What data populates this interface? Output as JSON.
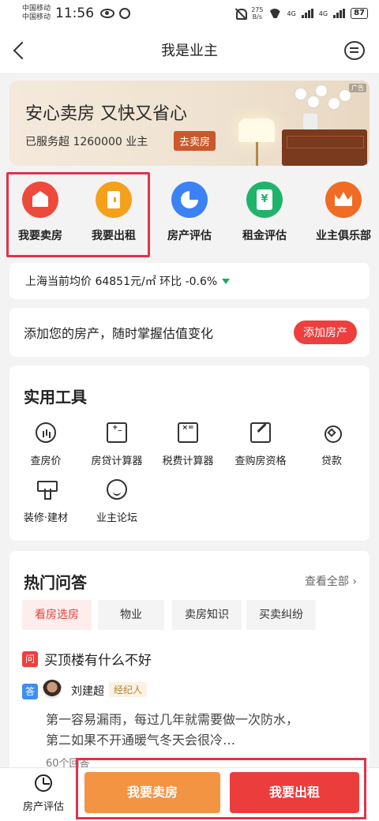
{
  "status_bar": {
    "carrier1": "中国移动",
    "carrier2": "中国移动",
    "time": "11:56",
    "net_speed_value": "275",
    "net_speed_unit": "B/s",
    "signal1": "4G",
    "signal2": "4G",
    "battery": "87"
  },
  "header": {
    "title": "我是业主"
  },
  "banner": {
    "title": "安心卖房 又快又省心",
    "subtitle": "已服务超 1260000 业主",
    "cta": "去卖房",
    "ad_tag": "广告"
  },
  "quick_entries": [
    {
      "label": "我要卖房",
      "color": "#ee4a3b",
      "icon": "house-icon"
    },
    {
      "label": "我要出租",
      "color": "#f5a01b",
      "icon": "door-icon"
    },
    {
      "label": "房产评估",
      "color": "#3b82f6",
      "icon": "pie-chart-icon"
    },
    {
      "label": "租金评估",
      "color": "#1fb46a",
      "icon": "rent-doc-icon"
    },
    {
      "label": "业主俱乐部",
      "color": "#f06b24",
      "icon": "crown-icon"
    }
  ],
  "price": {
    "text": "上海当前均价 64851元/㎡ 环比 -0.6%"
  },
  "add_property": {
    "text": "添加您的房产，随时掌握估值变化",
    "button": "添加房产"
  },
  "tools": {
    "title": "实用工具",
    "items": [
      {
        "label": "查房价",
        "icon": "price-chart-icon"
      },
      {
        "label": "房贷计算器",
        "icon": "loan-calculator-icon"
      },
      {
        "label": "税费计算器",
        "icon": "tax-calculator-icon"
      },
      {
        "label": "查购房资格",
        "icon": "eligibility-edit-icon"
      },
      {
        "label": "贷款",
        "icon": "loan-diamond-icon"
      },
      {
        "label": "装修·建材",
        "icon": "paint-roller-icon"
      },
      {
        "label": "业主论坛",
        "icon": "forum-face-icon"
      }
    ]
  },
  "qa": {
    "title": "热门问答",
    "more": "查看全部",
    "tabs": [
      "看房选房",
      "物业",
      "卖房知识",
      "买卖纠纷"
    ],
    "q_badge": "问",
    "question": "买顶楼有什么不好",
    "a_badge": "答",
    "author": "刘建超",
    "role": "经纪人",
    "answer_line1": "第一容易漏雨，每过几年就需要做一次防水，",
    "answer_line2": "第二如果不开通暖气冬天会很冷…",
    "reply_count": "60个回答"
  },
  "bottom_bar": {
    "estimate_label": "房产评估",
    "sell_button": "我要卖房",
    "rent_button": "我要出租"
  }
}
